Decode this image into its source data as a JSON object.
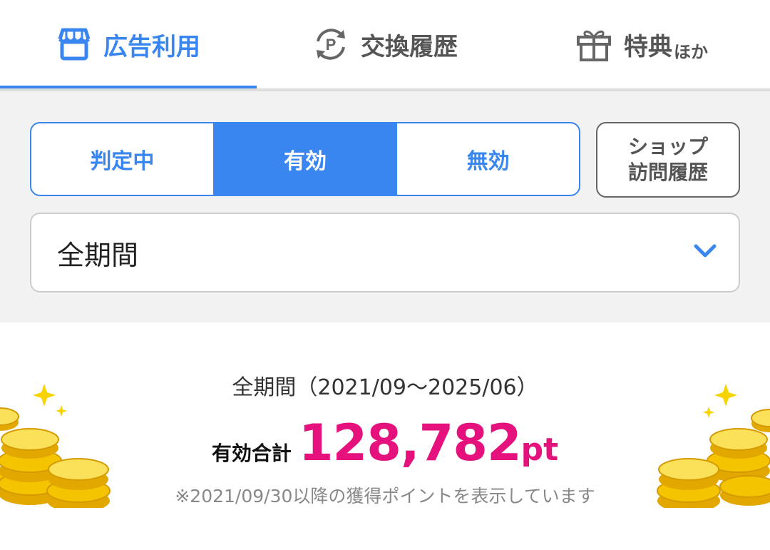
{
  "tabs": [
    {
      "label": "広告利用",
      "suffix": "",
      "icon": "shop-icon"
    },
    {
      "label": "交換履歴",
      "suffix": "",
      "icon": "point-exchange-icon"
    },
    {
      "label": "特典",
      "suffix": "ほか",
      "icon": "gift-icon"
    }
  ],
  "status_filter": {
    "options": [
      "判定中",
      "有効",
      "無効"
    ],
    "selected": "有効"
  },
  "shop_visit_button": {
    "line1": "ショップ",
    "line2": "訪問履歴"
  },
  "period_select": {
    "value": "全期間",
    "icon": "chevron-down-icon"
  },
  "summary": {
    "period_range": "全期間（2021/09〜2025/06）",
    "total_label": "有効合計",
    "total_value": "128,782",
    "total_unit": "pt",
    "note": "※2021/09/30以降の獲得ポイントを表示しています"
  },
  "colors": {
    "accent": "#3a86f0",
    "points": "#e5127d",
    "coin": "#f5c400"
  }
}
